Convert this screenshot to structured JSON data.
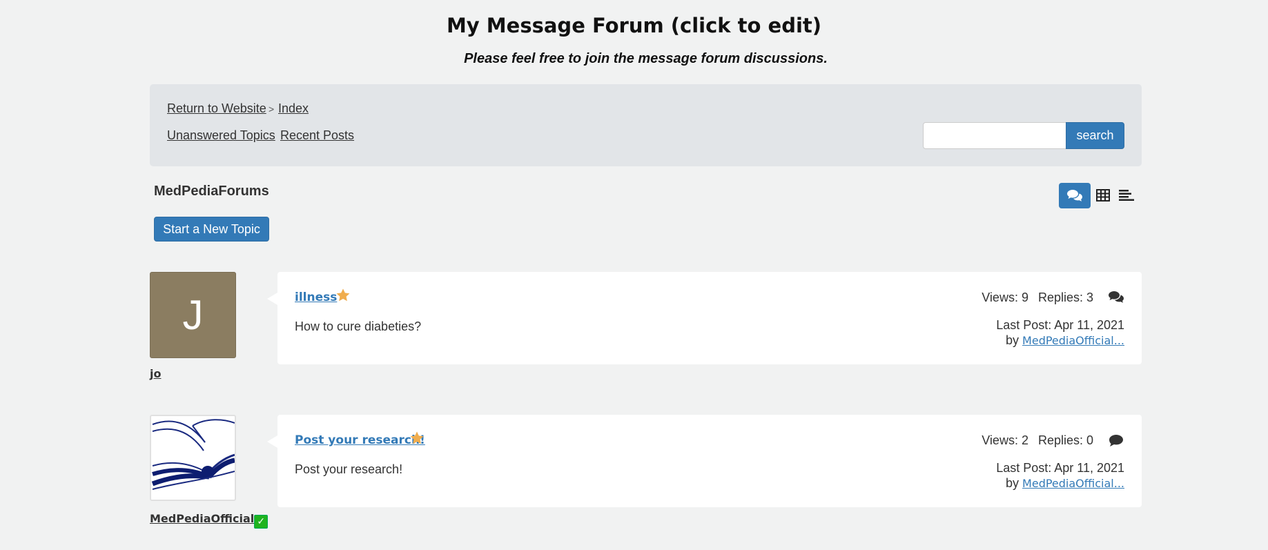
{
  "header": {
    "title": "My Message Forum (click to edit)",
    "subtitle": "Please feel free to join the message forum discussions."
  },
  "nav": {
    "return_link": "Return to Website",
    "separator": ">",
    "index_link": "Index",
    "unanswered_link": "Unanswered Topics",
    "recent_link": "Recent Posts",
    "search_placeholder": "",
    "search_button": "search"
  },
  "forum": {
    "name": "MedPediaForums",
    "new_topic_button": "Start a New Topic",
    "view_modes": [
      "comments-view-icon",
      "table-view-icon",
      "list-view-icon"
    ],
    "active_view": "comments-view-icon"
  },
  "colors": {
    "accent": "#337ab7",
    "star": "#f0ad4e",
    "avatar_bg": "#8b7d61",
    "verified": "#1fb31f"
  },
  "topics": [
    {
      "author": "jo",
      "avatar_letter": "J",
      "title": "illness",
      "starred": true,
      "excerpt": "How to cure diabeties?",
      "views": "Views: 9",
      "replies": "Replies: 3",
      "last_post": "Last Post: Apr 11, 2021",
      "by_label": "by",
      "last_author": "MedPediaOfficial..."
    },
    {
      "author": "MedPediaOfficial",
      "avatar_icon": "open-book-icon",
      "verified_icon": "check-badge-icon",
      "title": "Post your research! ",
      "starred": true,
      "excerpt": "Post your research!",
      "views": "Views: 2",
      "replies": "Replies: 0",
      "last_post": "Last Post: Apr 11, 2021",
      "by_label": "by",
      "last_author": "MedPediaOfficial..."
    }
  ]
}
